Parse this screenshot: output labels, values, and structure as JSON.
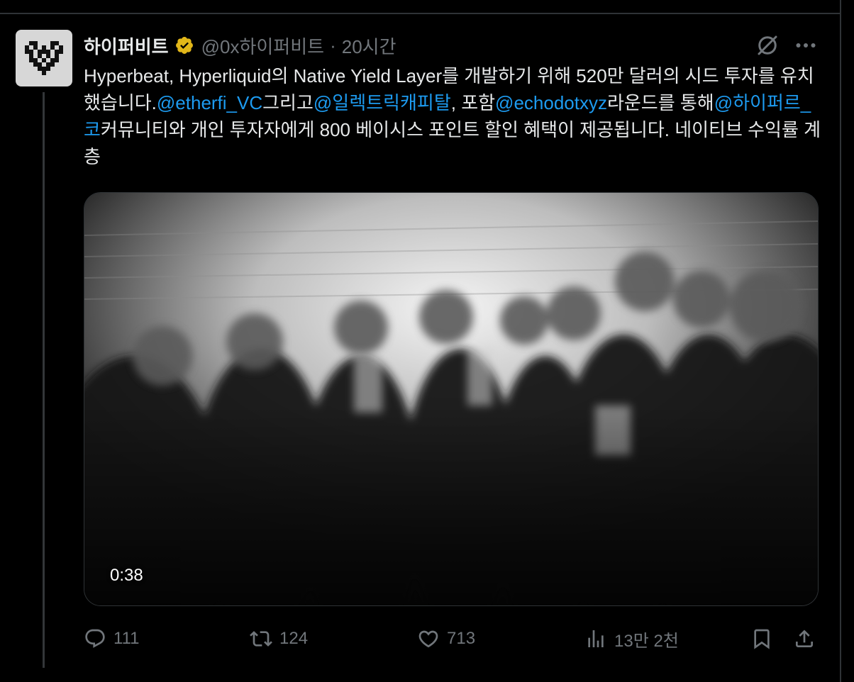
{
  "tweet": {
    "author_name": "하이퍼비트",
    "handle": "@0x하이퍼비트",
    "separator": "·",
    "time": "20시간",
    "text_parts": [
      {
        "text": "Hyperbeat, Hyperliquid의 Native Yield Layer를 개발하기 위해 520만 달러의 시드 투자를 유치했습니다.",
        "mention": false
      },
      {
        "text": "@etherfi_VC",
        "mention": true
      },
      {
        "text": "그리고",
        "mention": false
      },
      {
        "text": "@일렉트릭캐피탈",
        "mention": true
      },
      {
        "text": ", 포함",
        "mention": false
      },
      {
        "text": "@echodotxyz",
        "mention": true
      },
      {
        "text": "라운드를 통해",
        "mention": false
      },
      {
        "text": "@하이퍼르_코",
        "mention": true
      },
      {
        "text": "커뮤니티와 개인 투자자에게 800 베이시스 포인트 할인 혜택이 제공됩니다. 네이티브 수익률 계층",
        "mention": false
      }
    ],
    "media": {
      "duration": "0:38"
    },
    "actions": {
      "replies": "111",
      "retweets": "124",
      "likes": "713",
      "views": "13만 2천"
    }
  },
  "icons": {
    "verified": "verified-badge-icon",
    "grok": "grok-icon",
    "more": "more-icon",
    "reply": "reply-icon",
    "retweet": "retweet-icon",
    "like": "heart-icon",
    "views": "views-icon",
    "bookmark": "bookmark-icon",
    "share": "share-icon"
  },
  "colors": {
    "background": "#000000",
    "text": "#e7e9ea",
    "muted": "#71767b",
    "mention": "#1d9bf0",
    "verified": "#e2b719",
    "border": "#2f3336"
  }
}
